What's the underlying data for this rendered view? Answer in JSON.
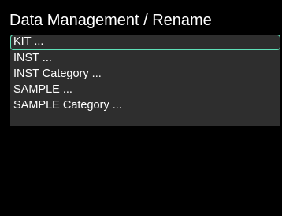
{
  "header": {
    "title": "Data Management / Rename"
  },
  "menu": {
    "items": [
      {
        "label": "KIT ...",
        "selected": true
      },
      {
        "label": "INST ...",
        "selected": false
      },
      {
        "label": "INST Category ...",
        "selected": false
      },
      {
        "label": "SAMPLE ...",
        "selected": false
      },
      {
        "label": "SAMPLE Category ...",
        "selected": false
      }
    ]
  },
  "colors": {
    "background": "#000000",
    "menu_background": "#2e2e2e",
    "selection_outline": "#5fe0b8",
    "text": "#ffffff"
  }
}
